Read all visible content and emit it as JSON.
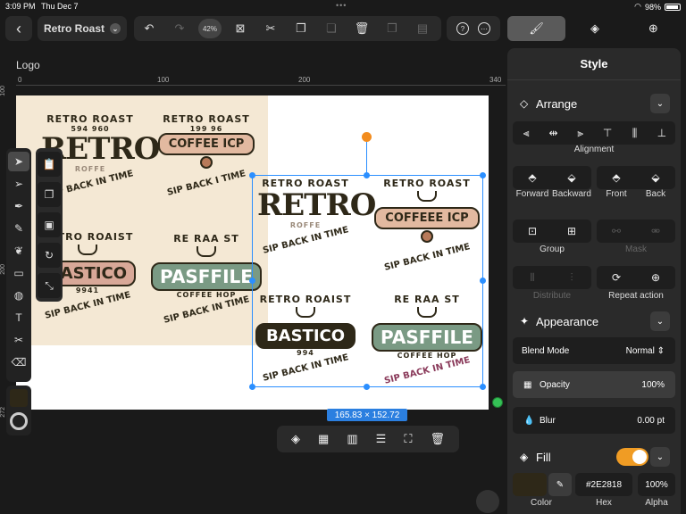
{
  "status": {
    "time": "3:09 PM",
    "date": "Thu Dec 7",
    "battery": "98%"
  },
  "document": {
    "title": "Retro Roast",
    "zoom": "42%"
  },
  "layer_name": "Logo",
  "ruler": {
    "h": [
      "0",
      "100",
      "200",
      "340"
    ],
    "v": [
      "100",
      "200",
      "272"
    ]
  },
  "selection_size": "165.83 × 152.72",
  "logos": [
    {
      "arc": "RETRO ROAST",
      "nums": "594   960",
      "big": "RETRO",
      "sub": "ROFFE",
      "tag": "SIP BACK IN TIME"
    },
    {
      "arc": "RETRO ROAST",
      "nums": "199   96",
      "pill": "COFFEE ICP",
      "tag": "SIP BACK I TIME"
    },
    {
      "arc": "RETRO ROAIST",
      "pill": "BASTICO",
      "nums": "9941",
      "tag": "SIP BACK IN TIME"
    },
    {
      "arc": "RE RAA ST",
      "pill": "PASFFILE",
      "sub": "COFFEE HOP",
      "tag": "SIP BACK IN TIME"
    },
    {
      "arc": "RETRO ROAST",
      "big": "RETRO",
      "sub": "ROFFE",
      "tag": "SIP BACK IN TIME"
    },
    {
      "arc": "RETRO ROAST",
      "pill": "COFFEEE ICP",
      "tag": "SIP BACK IN TIME"
    },
    {
      "arc": "RETRO ROAIST",
      "pill": "BASTICO",
      "nums": "994",
      "tag": "SIP BACK IN TIME"
    },
    {
      "arc": "RE RAA ST",
      "pill": "PASFFILE",
      "sub": "COFFEE HOP",
      "tag": "SIP BACK IN TIME"
    }
  ],
  "panel": {
    "title": "Style",
    "arrange": {
      "label": "Arrange",
      "alignment": "Alignment",
      "forward": "Forward",
      "backward": "Backward",
      "front": "Front",
      "back": "Back",
      "group": "Group",
      "mask": "Mask",
      "distribute": "Distribute",
      "repeat_action": "Repeat action"
    },
    "appearance": {
      "label": "Appearance",
      "blend_label": "Blend Mode",
      "blend_value": "Normal",
      "opacity_label": "Opacity",
      "opacity_value": "100%",
      "blur_label": "Blur",
      "blur_value": "0.00 pt"
    },
    "fill": {
      "label": "Fill",
      "enabled": true,
      "color": "#2E2818",
      "hex": "#2E2818",
      "alpha": "100%",
      "cap_color": "Color",
      "cap_hex": "Hex",
      "cap_alpha": "Alpha"
    }
  },
  "colors": {
    "accent": "#2b8fff",
    "toggle": "#f09c24",
    "rotation_handle": "#f28c1e",
    "brown": "#2e2818"
  }
}
